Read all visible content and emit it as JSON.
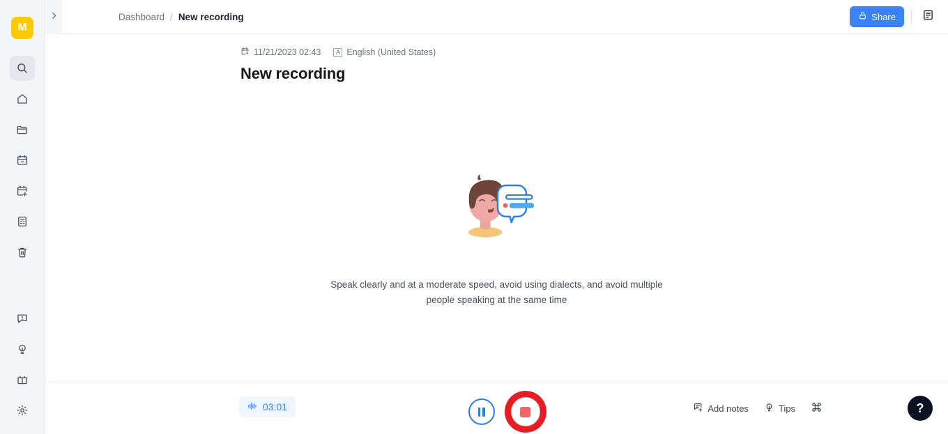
{
  "app": {
    "logo_text": "M",
    "brand_color": "#FFC800",
    "accent_color": "#3b82f6",
    "record_color": "#e81c24"
  },
  "sidebar": {
    "toggle_icon": "chevron-right-icon",
    "top_items": [
      {
        "label": "Search",
        "icon": "search-icon",
        "active": true
      },
      {
        "label": "Home",
        "icon": "home-icon",
        "active": false
      },
      {
        "label": "Folders",
        "icon": "folder-icon",
        "active": false
      },
      {
        "label": "Calendar",
        "icon": "calendar-icon",
        "active": false
      },
      {
        "label": "New event",
        "icon": "calendar-plus-icon",
        "active": false
      },
      {
        "label": "Notes",
        "icon": "document-list-icon",
        "active": false
      },
      {
        "label": "Trash",
        "icon": "trash-icon",
        "active": false
      }
    ],
    "bottom_items": [
      {
        "label": "Feedback",
        "icon": "message-alert-icon"
      },
      {
        "label": "Tips",
        "icon": "lightbulb-icon"
      },
      {
        "label": "Gifts",
        "icon": "gift-icon"
      },
      {
        "label": "Settings",
        "icon": "gear-icon"
      }
    ]
  },
  "topbar": {
    "breadcrumb": {
      "root": "Dashboard",
      "separator": "/",
      "current": "New recording"
    },
    "share_label": "Share",
    "share_icon": "lock-icon",
    "notes_icon": "notes-panel-icon"
  },
  "recording": {
    "date": "11/21/2023 02:43",
    "date_icon": "calendar-icon",
    "language": "English (United States)",
    "language_icon": "language-a-icon",
    "title": "New recording",
    "hint": "Speak clearly and at a moderate speed, avoid using dialects, and avoid multiple people speaking at the same time",
    "illustration": "person-speaking-illustration"
  },
  "controls": {
    "timer": "03:01",
    "timer_icon": "waveform-icon",
    "pause_label": "Pause",
    "pause_icon": "pause-icon",
    "stop_label": "Stop recording",
    "stop_icon": "stop-square-icon",
    "add_notes_label": "Add notes",
    "add_notes_icon": "note-plus-icon",
    "tips_label": "Tips",
    "tips_icon": "lightbulb-icon",
    "shortcuts_icon": "command-key-icon",
    "help_label": "?",
    "help_icon": "question-mark-icon"
  }
}
